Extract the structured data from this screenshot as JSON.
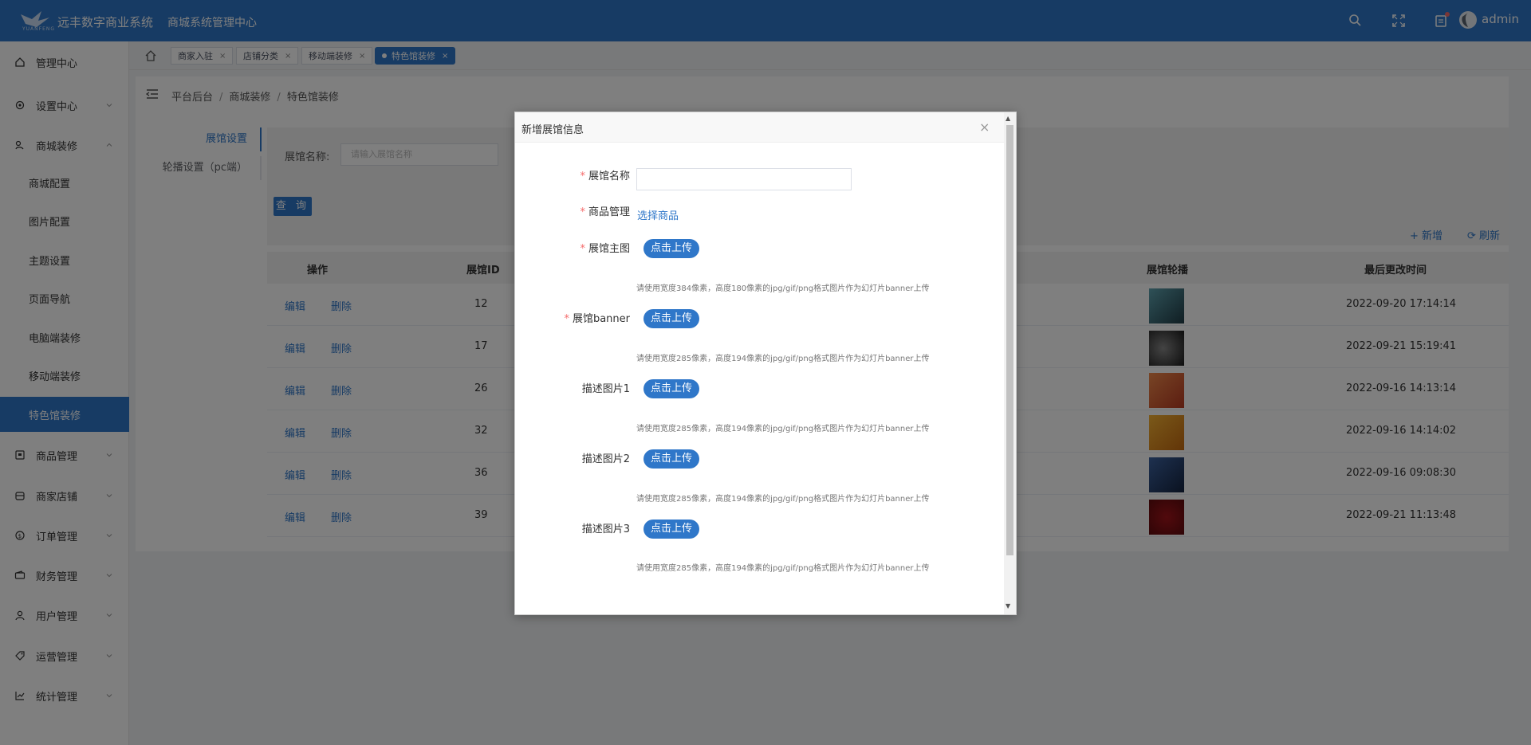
{
  "header": {
    "logo_text": "YUANFENG",
    "app_title": "远丰数字商业系统",
    "app_subtitle": "商城系统管理中心",
    "user_name": "admin",
    "bg_color": "#2f77c9"
  },
  "sidebar": {
    "items": [
      {
        "label": "管理中心",
        "icon": "home-icon",
        "has_arrow": false
      },
      {
        "label": "设置中心",
        "icon": "gear-icon",
        "has_arrow": true
      },
      {
        "label": "商城装修",
        "icon": "decor-icon",
        "has_arrow": true,
        "expanded": true
      },
      {
        "label": "商品管理",
        "icon": "goods-icon",
        "has_arrow": true
      },
      {
        "label": "商家店铺",
        "icon": "store-icon",
        "has_arrow": true
      },
      {
        "label": "订单管理",
        "icon": "order-icon",
        "has_arrow": true
      },
      {
        "label": "财务管理",
        "icon": "wallet-icon",
        "has_arrow": true
      },
      {
        "label": "用户管理",
        "icon": "user-icon",
        "has_arrow": true
      },
      {
        "label": "运营管理",
        "icon": "tag-icon",
        "has_arrow": true
      },
      {
        "label": "统计管理",
        "icon": "chart-icon",
        "has_arrow": true
      }
    ],
    "sub_items": [
      "商城配置",
      "图片配置",
      "主题设置",
      "页面导航",
      "电脑端装修",
      "移动端装修",
      "特色馆装修"
    ],
    "active_sub": "特色馆装修"
  },
  "tabs": [
    {
      "label": "商家入驻",
      "active": false
    },
    {
      "label": "店铺分类",
      "active": false
    },
    {
      "label": "移动端装修",
      "active": false
    },
    {
      "label": "特色馆装修",
      "active": true
    }
  ],
  "tab_close": "×",
  "breadcrumb": [
    "平台后台",
    "商城装修",
    "特色馆装修"
  ],
  "breadcrumb_sep": "/",
  "content": {
    "vtabs": [
      "展馆设置",
      "轮播设置（pc端）"
    ],
    "search_label": "展馆名称:",
    "search_placeholder": "请输入展馆名称",
    "search_button": "查 询",
    "add_label": "+ 新增",
    "refresh_label": "⟳ 刷新",
    "columns": {
      "op": "操作",
      "id": "展馆ID",
      "carousel": "展馆轮播",
      "time": "最后更改时间"
    },
    "edit_label": "编辑",
    "delete_label": "删除",
    "rows": [
      {
        "id": "12",
        "time": "2022-09-20 17:14:14",
        "thumb": "#3f6c7a"
      },
      {
        "id": "17",
        "time": "2022-09-21 15:19:41",
        "thumb": "#3a3a3a"
      },
      {
        "id": "26",
        "time": "2022-09-16 14:13:14",
        "thumb": "#d8672e"
      },
      {
        "id": "32",
        "time": "2022-09-16 14:14:02",
        "thumb": "#e08a1c"
      },
      {
        "id": "36",
        "time": "2022-09-16 09:08:30",
        "thumb": "#2c4a78"
      },
      {
        "id": "39",
        "time": "2022-09-21 11:13:48",
        "thumb": "#8a0f12"
      }
    ]
  },
  "modal": {
    "title": "新增展馆信息",
    "close": "×",
    "scroll_up": "▲",
    "scroll_down": "▼",
    "required_mark": "*",
    "fields": {
      "name_label": "展馆名称",
      "goods_label": "商品管理",
      "goods_link": "选择商品",
      "main_label": "展馆主图",
      "banner_label": "展馆banner",
      "desc1_label": "描述图片1",
      "desc2_label": "描述图片2",
      "desc3_label": "描述图片3"
    },
    "upload_label": "点击上传",
    "hint_main": "请使用宽度384像素，高度180像素的jpg/gif/png格式图片作为幻灯片banner上传",
    "hint_other": "请使用宽度285像素，高度194像素的jpg/gif/png格式图片作为幻灯片banner上传"
  }
}
